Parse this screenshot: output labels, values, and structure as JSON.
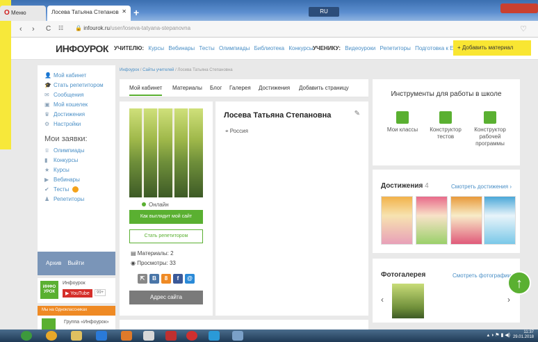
{
  "browser": {
    "menu_tab": "Меню",
    "page_tab": "Лосева Татьяна Степанов",
    "lang": "RU",
    "url_domain": "infourok.ru",
    "url_path": "/user/loseva-tatyana-stepanovna"
  },
  "header": {
    "logo": "ИНФОУРОК",
    "teacher_label": "УЧИТЕЛЮ:",
    "teacher_links": [
      "Курсы",
      "Вебинары",
      "Тесты",
      "Олимпиады",
      "Библиотека",
      "Конкурсы"
    ],
    "student_label": "УЧЕНИКУ:",
    "student_links": [
      "Видеоуроки",
      "Репетиторы",
      "Подготовка к ЕГЭ"
    ],
    "add_material": "Добавить материал"
  },
  "sidebar": {
    "items": [
      {
        "icon": "person-icon",
        "label": "Мой кабинет"
      },
      {
        "icon": "hat-icon",
        "label": "Стать репетитором"
      },
      {
        "icon": "message-icon",
        "label": "Сообщения"
      },
      {
        "icon": "wallet-icon",
        "label": "Мой кошелек"
      },
      {
        "icon": "trophy-icon",
        "label": "Достижения"
      },
      {
        "icon": "gear-icon",
        "label": "Настройки"
      }
    ],
    "requests_title": "Мои заявки:",
    "requests": [
      {
        "icon": "cup-icon",
        "label": "Олимпиады"
      },
      {
        "icon": "bars-icon",
        "label": "Конкурсы"
      },
      {
        "icon": "star-icon",
        "label": "Курсы"
      },
      {
        "icon": "play-icon",
        "label": "Вебинары"
      },
      {
        "icon": "check-icon",
        "label": "Тесты"
      },
      {
        "icon": "tutor-icon",
        "label": "Репетиторы"
      }
    ],
    "archive": "Архив",
    "logout": "Выйти",
    "info_name": "Инфоурок",
    "info_logo": "ИНФО УРОК",
    "youtube": "YouTube",
    "youtube_count": "99+",
    "ok_bar": "Мы на Одноклассниках",
    "ok_group": "Группа «Инфоурок»"
  },
  "breadcrumb": {
    "home": "Инфоурок",
    "sites": "Сайты учителей",
    "current": "Лосева Татьяна Степановна"
  },
  "profile_tabs": [
    "Мой кабинет",
    "Материалы",
    "Блог",
    "Галерея",
    "Достижения",
    "Добавить страницу"
  ],
  "profile": {
    "name": "Лосева Татьяна Степановна",
    "country": "Россия",
    "status": "Онлайн",
    "site_button": "Как выглядит мой сайт",
    "tutor_button": "Стать репетитором",
    "materials": "Материалы: 2",
    "views": "Просмотры: 33",
    "address_button": "Адрес сайта"
  },
  "tools": {
    "title": "Инструменты для работы в школе",
    "items": [
      "Мои классы",
      "Конструктор тестов",
      "Конструктор рабочей программы"
    ]
  },
  "achievements": {
    "title": "Достижения",
    "count": "4",
    "link": "Смотреть достижения ›"
  },
  "gallery": {
    "title": "Фотогалерея",
    "link": "Смотреть фотографии ›"
  },
  "taskbar": {
    "time": "11:37",
    "date": "29.01.2018"
  },
  "colors": {
    "accent_green": "#5ab031",
    "link_blue": "#4a8fc6",
    "yellow": "#f9e632"
  }
}
